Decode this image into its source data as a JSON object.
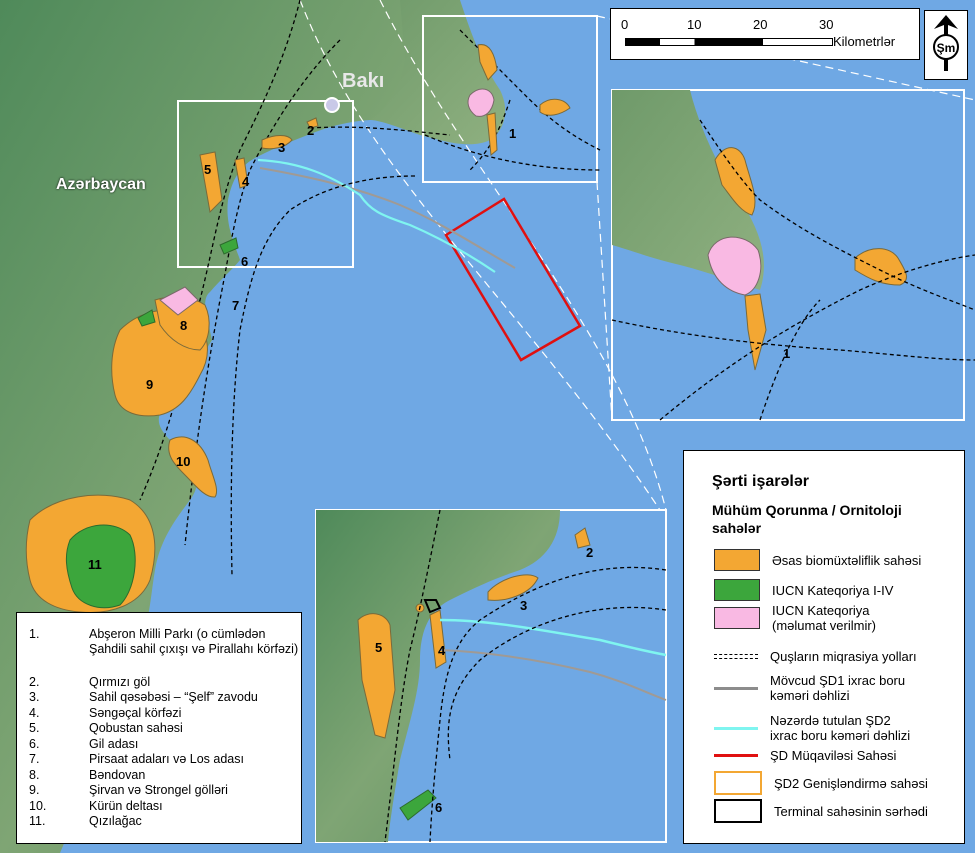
{
  "map": {
    "city_label": "Bakı",
    "country_label": "Azərbaycan",
    "area_numbers": [
      "1",
      "2",
      "3",
      "4",
      "5",
      "6",
      "7",
      "8",
      "9",
      "10",
      "11"
    ]
  },
  "scale": {
    "ticks": [
      "0",
      "10",
      "20",
      "30"
    ],
    "unit": "Kilometrlər"
  },
  "north_symbol": "Şm",
  "legend": {
    "title": "Şərti işarələr",
    "subtitle": "Mühüm Qorunma / Ornitoloji sahələr",
    "items": [
      {
        "label": "Əsas biomüxtəliflik sahəsi",
        "kind": "fill",
        "color": "#f3a733"
      },
      {
        "label": "IUCN Kateqoriya I-IV",
        "kind": "fill",
        "color": "#3ca63c"
      },
      {
        "label": "IUCN Kateqoriya (məlumat verilmir)",
        "kind": "fill",
        "color": "#f9b9e3"
      },
      {
        "label": "Quşların miqrasiya yolları",
        "kind": "dashed",
        "color": "#000000"
      },
      {
        "label": "Mövcud ŞD1 ixrac boru kəməri dəhlizi",
        "kind": "line",
        "color": "#8c8c8c"
      },
      {
        "label": "Nəzərdə tutulan ŞD2 ixrac boru kəməri dəhlizi",
        "kind": "line",
        "color": "#7ff5f0"
      },
      {
        "label": "ŞD Müqaviləsi Sahəsi",
        "kind": "line",
        "color": "#e01010"
      },
      {
        "label": "ŞD2 Genişləndirmə sahəsi",
        "kind": "outline",
        "color": "#f3a733"
      },
      {
        "label": "Terminal sahəsinin sərhədi",
        "kind": "outline",
        "color": "#000000"
      }
    ]
  },
  "sites": [
    {
      "num": "1.",
      "name": "Abşeron Milli Parkı (o cümlədən Şahdili sahil çıxışı və Pirallahı körfəzi)"
    },
    {
      "num": "2.",
      "name": "Qırmızı göl"
    },
    {
      "num": "3.",
      "name": "Sahil qəsəbəsi – “Şelf” zavodu"
    },
    {
      "num": "4.",
      "name": "Səngəçal körfəzi"
    },
    {
      "num": "5.",
      "name": "Qobustan sahəsi"
    },
    {
      "num": "6.",
      "name": "Gil adası"
    },
    {
      "num": "7.",
      "name": "Pirsaat adaları və Los adası"
    },
    {
      "num": "8.",
      "name": "Bəndovan"
    },
    {
      "num": "9.",
      "name": "Şirvan və Strongel gölləri"
    },
    {
      "num": "10.",
      "name": "Kürün deltası"
    },
    {
      "num": "11.",
      "name": "Qızılağac"
    }
  ]
}
